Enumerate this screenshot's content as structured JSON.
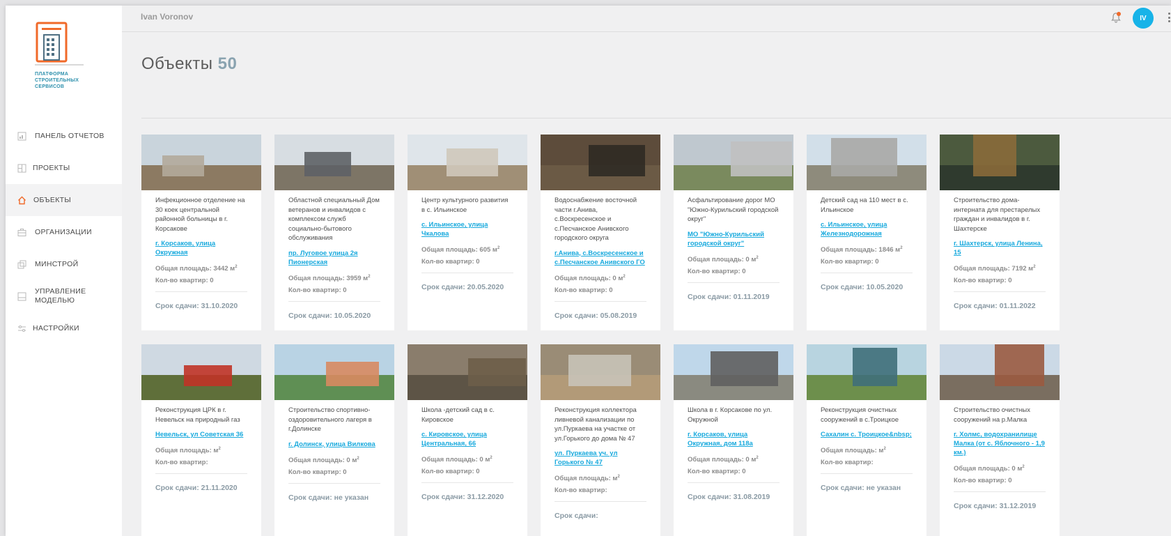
{
  "user": {
    "name": "Ivan Voronov",
    "initials": "IV"
  },
  "logo": {
    "lines": [
      "ПЛАТФОРМА",
      "СТРОИТЕЛЬНЫХ",
      "СЕРВИСОВ"
    ]
  },
  "nav": [
    {
      "label": "ПАНЕЛЬ ОТЧЕТОВ",
      "icon": "report-icon"
    },
    {
      "label": "ПРОЕКТЫ",
      "icon": "projects-icon"
    },
    {
      "label": "ОБЪЕКТЫ",
      "icon": "home-icon",
      "active": true
    },
    {
      "label": "ОРГАНИЗАЦИИ",
      "icon": "briefcase-icon"
    },
    {
      "label": "МИНСТРОЙ",
      "icon": "ministry-icon"
    },
    {
      "label": "УПРАВЛЕНИЕ МОДЕЛЬЮ",
      "icon": "model-icon"
    },
    {
      "label": "НАСТРОЙКИ",
      "icon": "settings-icon"
    }
  ],
  "page": {
    "title": "Объекты",
    "count": "50"
  },
  "labels": {
    "area": "Общая площадь:",
    "flats": "Кол-во квартир:",
    "due": "Срок сдачи:"
  },
  "cards": [
    {
      "name": "Инфекционное отделение на 30 коек центральной районной больницы в г. Корсакове",
      "address": "г. Корсаков, улица Окружная",
      "area": "3442 м",
      "flats": "0",
      "due": "31.10.2020"
    },
    {
      "name": "Областной специальный Дом ветеранов и инвалидов с комплексом служб социально-бытового обслуживания",
      "address": "пр. Луговое улица 2я Пионерская",
      "area": "3959 м",
      "flats": "0",
      "due": "10.05.2020"
    },
    {
      "name": "Центр культурного развития в с. Ильинское",
      "address": "с. Ильинское, улица Чкалова",
      "area": "605 м",
      "flats": "0",
      "due": "20.05.2020"
    },
    {
      "name": "Водоснабжение восточной части г.Анива, с.Воскресенское и с.Песчанское Анивского городского округа",
      "address": "г.Анива, с.Воскресенское и с.Песчанское Анивского ГО",
      "area": "0 м",
      "flats": "0",
      "due": "05.08.2019"
    },
    {
      "name": "Асфальтирование дорог МО \"Южно-Курильский городской округ\"",
      "address": "МО \"Южно-Курильский городской округ\"",
      "area": "0 м",
      "flats": "0",
      "due": "01.11.2019"
    },
    {
      "name": "Детский сад на 110 мест в с. Ильинское",
      "address": "с. Ильинское, улица Железнодорожная",
      "area": "1846 м",
      "flats": "0",
      "due": "10.05.2020"
    },
    {
      "name": "Строительство дома-интерната для престарелых граждан и инвалидов в г. Шахтерске",
      "address": "г. Шахтерск, улица Ленина, 15",
      "area": "7192 м",
      "flats": "0",
      "due": "01.11.2022"
    },
    {
      "name": "Реконструкция ЦРК в г. Невельск на природный газ",
      "address": "Невельск, ул Советская 36",
      "area": "м",
      "flats": "",
      "due": "21.11.2020"
    },
    {
      "name": "Строительство спортивно-оздоровительного лагеря в г.Долинске",
      "address": "г. Долинск, улица Вилкова",
      "area": "0 м",
      "flats": "0",
      "due": "не указан"
    },
    {
      "name": "Школа -детский сад в с. Кировское",
      "address": "с. Кировское, улица Центральная, 66",
      "area": "0 м",
      "flats": "0",
      "due": "31.12.2020"
    },
    {
      "name": "Реконструкция коллектора ливневой канализации по ул.Пуркаева на участке от ул.Горького до дома № 47",
      "address": "ул. Пуркаева уч. ул Горького № 47",
      "area": "м",
      "flats": "",
      "due": ""
    },
    {
      "name": "Школа в г. Корсакове по ул. Окружной",
      "address": "г. Корсаков, улица Окружная, дом 118а",
      "area": "0 м",
      "flats": "0",
      "due": "31.08.2019"
    },
    {
      "name": "Реконструкция очистных сооружений в с.Троицкое",
      "address": "Сахалин с. Троицкое&nbsp;",
      "area": "м",
      "flats": "",
      "due": "не указан"
    },
    {
      "name": "Строительство очистных сооружений на р.Малка",
      "address": "г. Холмс, водохранилище Малка (от с. Яблочного - 1,9 км.)",
      "area": "0 м",
      "flats": "0",
      "due": "31.12.2019"
    }
  ],
  "colors": {
    "accent": "#17a9dd",
    "avatar": "#17b3e8",
    "logo_orange": "#f06a2a"
  }
}
